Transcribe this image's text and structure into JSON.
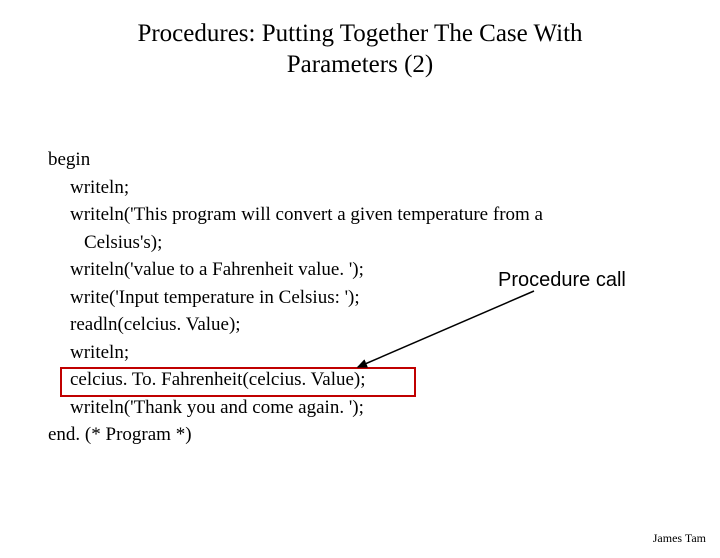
{
  "title_line1": "Procedures: Putting Together The Case With",
  "title_line2": "Parameters (2)",
  "code": {
    "l1": "begin",
    "l2": "writeln;",
    "l3": "writeln('This program will convert a given temperature from a",
    "l4": "Celsius's);",
    "l5": "writeln('value to a Fahrenheit value. ');",
    "l6": "write('Input temperature in Celsius: ');",
    "l7": "readln(celcius. Value);",
    "l8": "writeln;",
    "l9": "celcius. To. Fahrenheit(celcius. Value);",
    "l10": "writeln('Thank you and come again. ');",
    "l11": "end. (* Program *)"
  },
  "annotation": "Procedure call",
  "footer": "James Tam",
  "highlight_color": "#c00000"
}
